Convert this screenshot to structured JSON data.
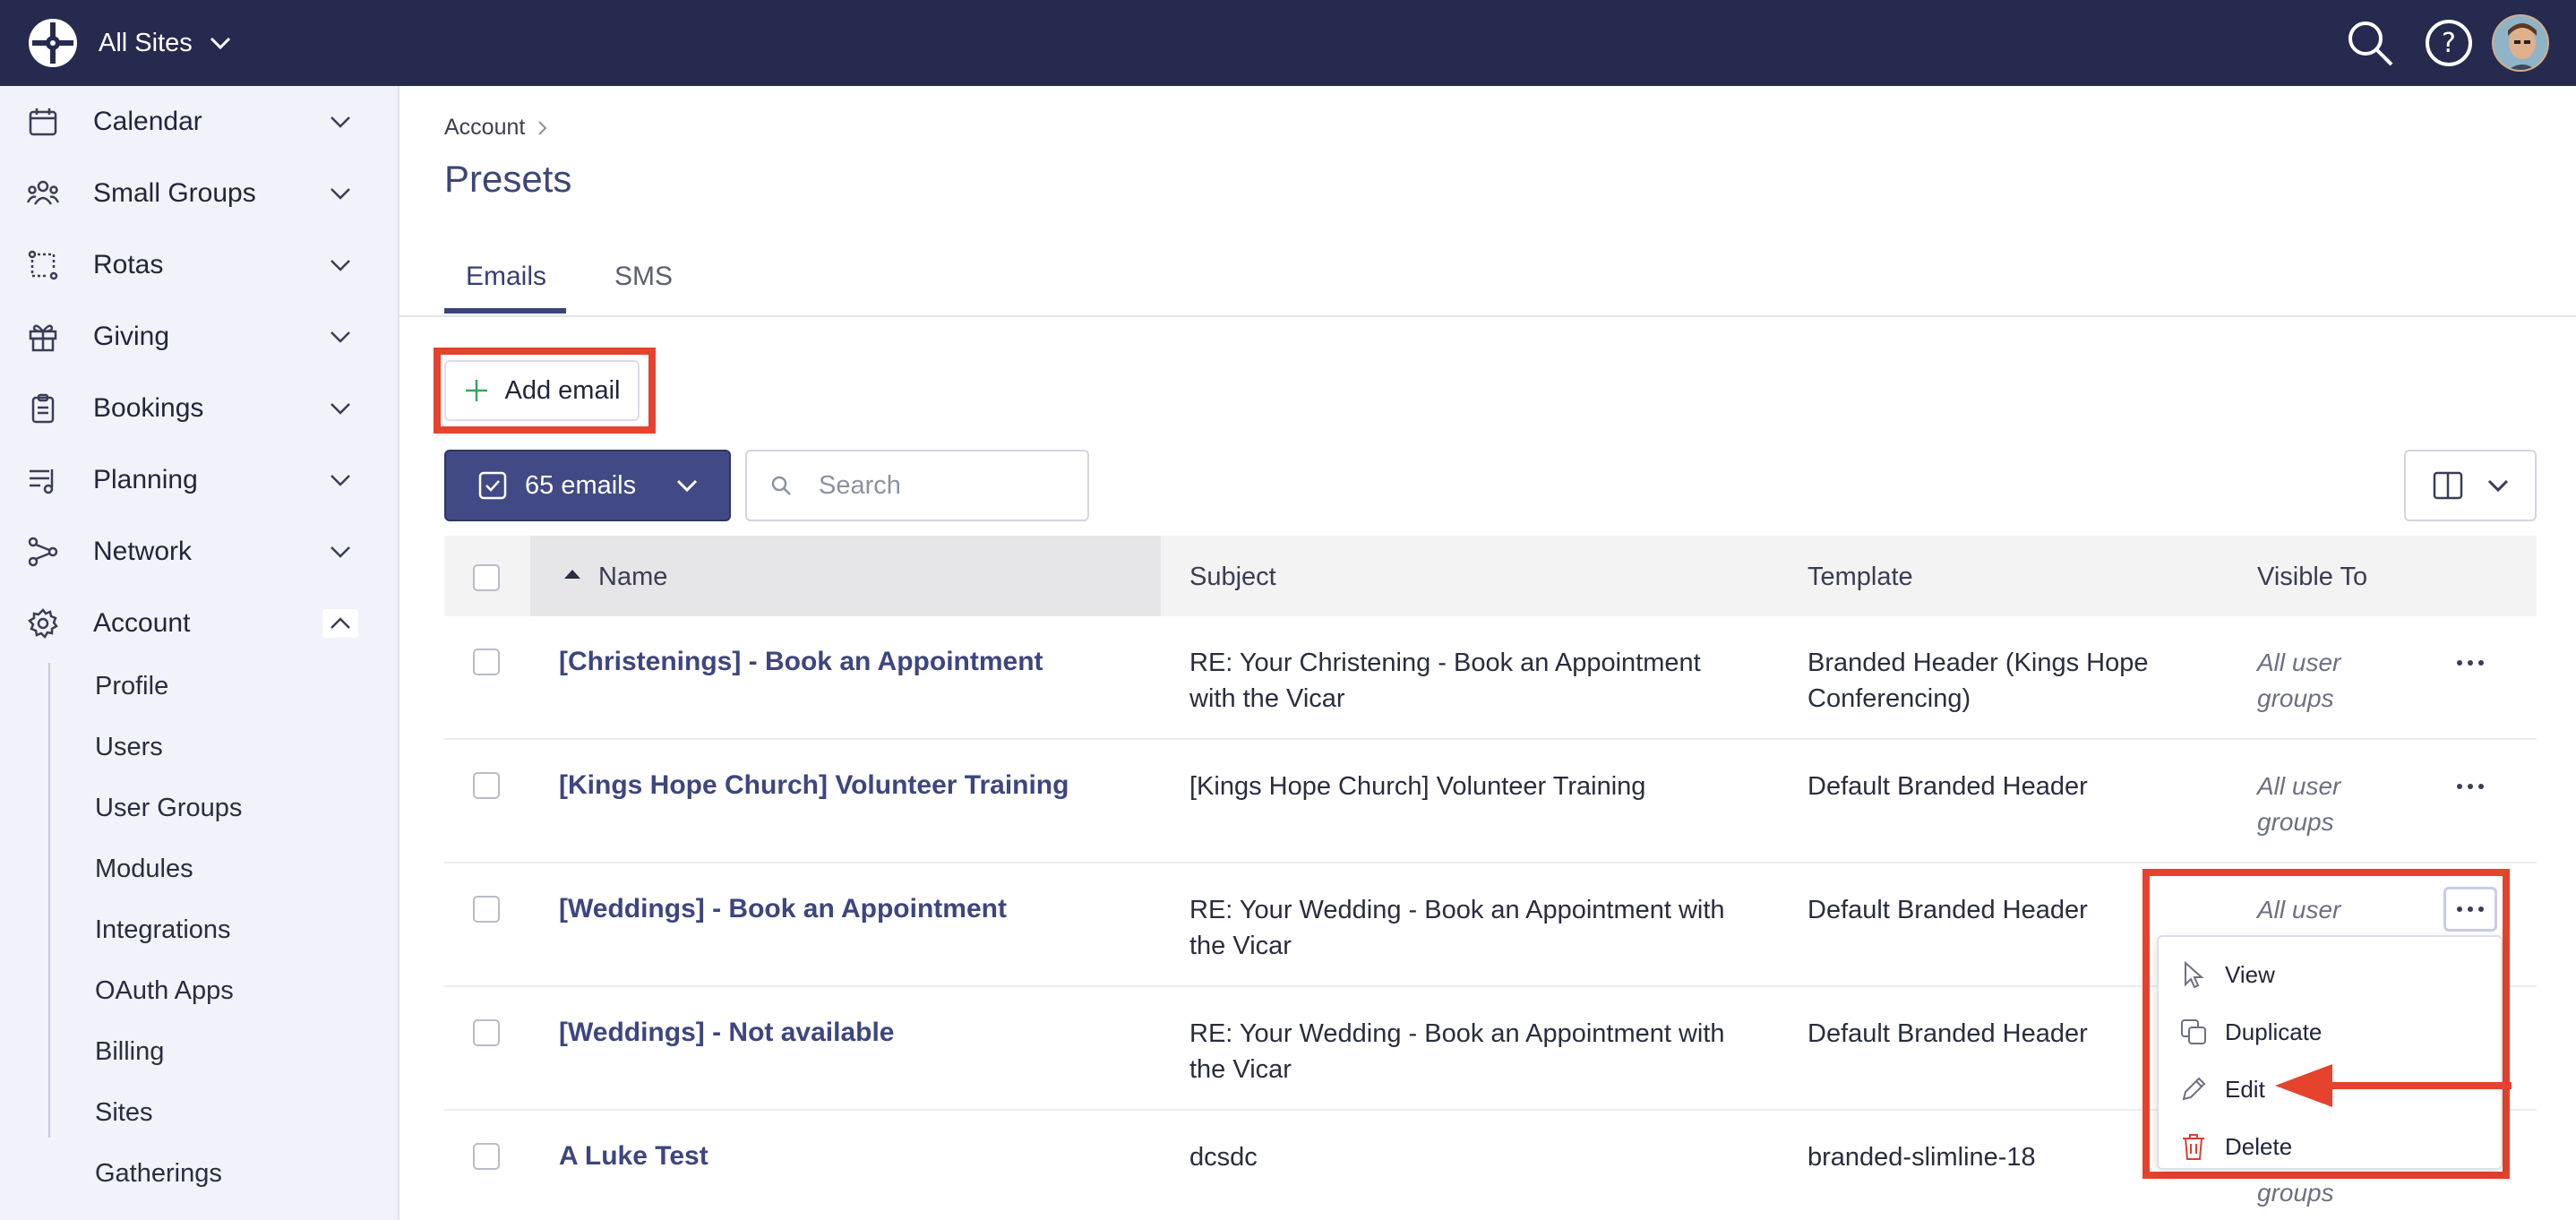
{
  "topbar": {
    "site_switcher": "All Sites",
    "bg_color": "#272a4f"
  },
  "sidebar": {
    "items": [
      {
        "label": "Calendar",
        "icon": "calendar-icon"
      },
      {
        "label": "Small Groups",
        "icon": "people-icon"
      },
      {
        "label": "Rotas",
        "icon": "rota-icon"
      },
      {
        "label": "Giving",
        "icon": "gift-icon"
      },
      {
        "label": "Bookings",
        "icon": "clipboard-icon"
      },
      {
        "label": "Planning",
        "icon": "planning-icon"
      },
      {
        "label": "Network",
        "icon": "network-icon"
      },
      {
        "label": "Account",
        "icon": "gear-icon"
      }
    ],
    "account_subitems": [
      "Profile",
      "Users",
      "User Groups",
      "Modules",
      "Integrations",
      "OAuth Apps",
      "Billing",
      "Sites",
      "Gatherings"
    ]
  },
  "breadcrumb": {
    "parent": "Account"
  },
  "page": {
    "title": "Presets"
  },
  "tabs": [
    {
      "label": "Emails",
      "active": true
    },
    {
      "label": "SMS",
      "active": false
    }
  ],
  "toolbar": {
    "add_label": "Add email",
    "bulk_label": "65 emails",
    "search_placeholder": "Search"
  },
  "table": {
    "headers": {
      "name": "Name",
      "subject": "Subject",
      "template": "Template",
      "visible": "Visible To"
    },
    "rows": [
      {
        "name": "[Christenings] - Book an Appointment",
        "subject_l1": "RE: Your Christening - Book an Appointment",
        "subject_l2": "with the Vicar",
        "template_l1": "Branded Header (Kings Hope",
        "template_l2": "Conferencing)",
        "visible_l1": "All user",
        "visible_l2": "groups"
      },
      {
        "name": "[Kings Hope Church] Volunteer Training",
        "subject_l1": "[Kings Hope Church] Volunteer Training",
        "subject_l2": "",
        "template_l1": "Default Branded Header",
        "template_l2": "",
        "visible_l1": "All user",
        "visible_l2": "groups"
      },
      {
        "name": "[Weddings] - Book an Appointment",
        "subject_l1": "RE: Your Wedding - Book an Appointment with",
        "subject_l2": "the Vicar",
        "template_l1": "Default Branded Header",
        "template_l2": "",
        "visible_l1": "All user",
        "visible_l2": ""
      },
      {
        "name": "[Weddings] - Not available",
        "subject_l1": "RE: Your Wedding - Book an Appointment with",
        "subject_l2": "the Vicar",
        "template_l1": "Default Branded Header",
        "template_l2": "",
        "visible_l1": "",
        "visible_l2": ""
      },
      {
        "name": "A Luke Test",
        "subject_l1": "dcsdc",
        "subject_l2": "",
        "template_l1": "branded-slimline-18",
        "template_l2": "",
        "visible_l1": "",
        "visible_l2": "groups"
      }
    ]
  },
  "row_menu": {
    "items": [
      {
        "label": "View",
        "icon": "pointer-icon"
      },
      {
        "label": "Duplicate",
        "icon": "duplicate-icon"
      },
      {
        "label": "Edit",
        "icon": "pencil-icon"
      },
      {
        "label": "Delete",
        "icon": "trash-icon"
      }
    ]
  },
  "colors": {
    "accent": "#414a85",
    "highlight": "#e5432d",
    "link": "#3d4680",
    "danger": "#d9412f"
  }
}
